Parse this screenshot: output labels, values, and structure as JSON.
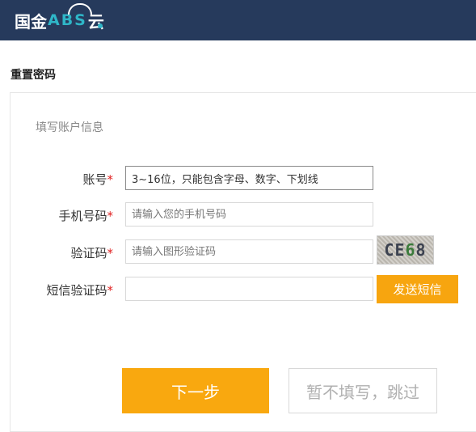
{
  "header": {
    "logo_cn": "国金",
    "logo_abs": "ABS",
    "logo_z": "云"
  },
  "page": {
    "title": "重置密码",
    "section_title": "填写账户信息"
  },
  "form": {
    "account": {
      "label": "账号",
      "required": "*",
      "value": "3~16位，只能包含字母、数字、下划线"
    },
    "phone": {
      "label": "手机号码",
      "required": "*",
      "placeholder": "请输入您的手机号码"
    },
    "captcha": {
      "label": "验证码",
      "required": "*",
      "placeholder": "请输入图形验证码",
      "image_text": [
        "C",
        "E",
        "6",
        "8"
      ]
    },
    "sms": {
      "label": "短信验证码",
      "required": "*",
      "placeholder": "",
      "button": "发送短信"
    }
  },
  "actions": {
    "next": "下一步",
    "skip": "暂不填写，跳过"
  },
  "colors": {
    "header_bg": "#263a5c",
    "accent": "#f7a50f",
    "logo_accent": "#2fb6c8"
  }
}
